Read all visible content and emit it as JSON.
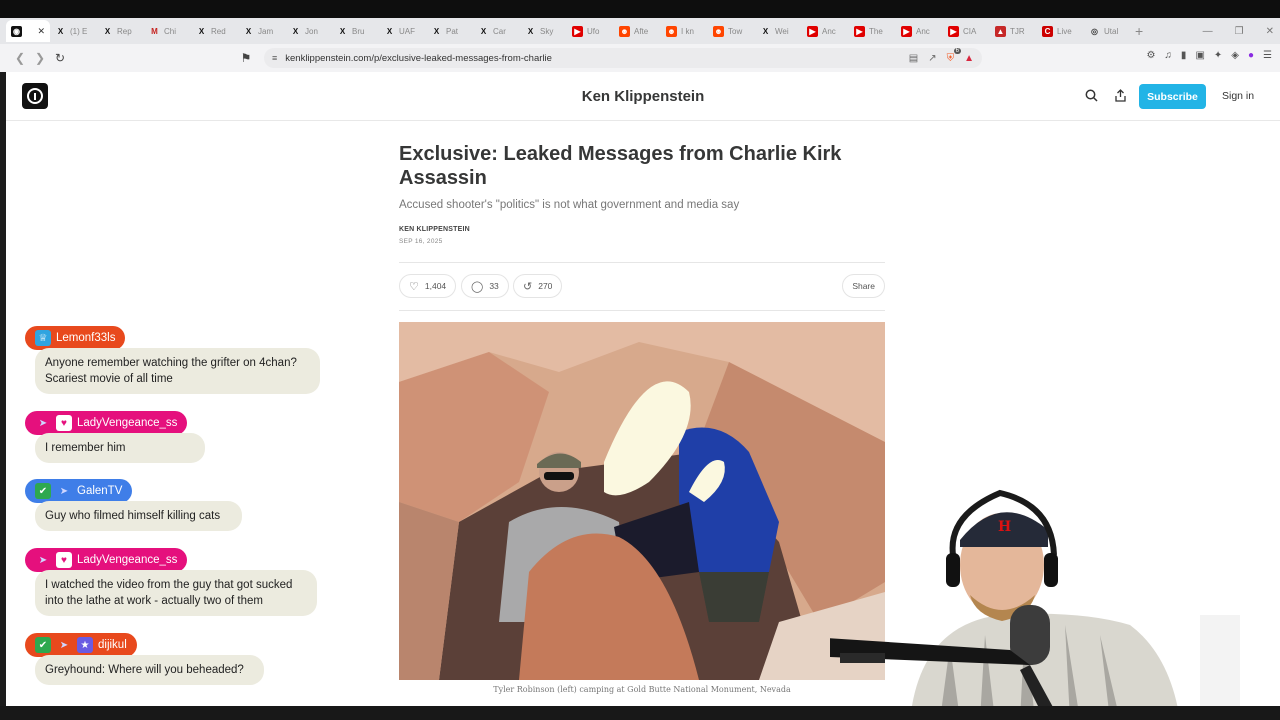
{
  "browser": {
    "tabs": [
      {
        "label": "",
        "fav": "site",
        "color": "#111111",
        "active": true
      },
      {
        "label": "(1) E",
        "fav": "x",
        "color": "#111111"
      },
      {
        "label": "Rep",
        "fav": "x",
        "color": "#111111"
      },
      {
        "label": "Chi",
        "fav": "gmail",
        "color": "#c5221f"
      },
      {
        "label": "Red",
        "fav": "x",
        "color": "#111111"
      },
      {
        "label": "Jam",
        "fav": "x",
        "color": "#111111"
      },
      {
        "label": "Jon",
        "fav": "x",
        "color": "#111111"
      },
      {
        "label": "Bru",
        "fav": "x",
        "color": "#111111"
      },
      {
        "label": "UAF",
        "fav": "x",
        "color": "#111111"
      },
      {
        "label": "Pat",
        "fav": "x",
        "color": "#111111"
      },
      {
        "label": "Car",
        "fav": "x",
        "color": "#111111"
      },
      {
        "label": "Sky",
        "fav": "x",
        "color": "#111111"
      },
      {
        "label": "Ufo",
        "fav": "youtube",
        "color": "#e00000"
      },
      {
        "label": "Afte",
        "fav": "reddit",
        "color": "#ff4500"
      },
      {
        "label": "I kn",
        "fav": "reddit",
        "color": "#ff4500"
      },
      {
        "label": "Tow",
        "fav": "reddit",
        "color": "#ff4500"
      },
      {
        "label": "Wei",
        "fav": "x",
        "color": "#111111"
      },
      {
        "label": "Anc",
        "fav": "youtube",
        "color": "#e00000"
      },
      {
        "label": "The",
        "fav": "youtube",
        "color": "#e00000"
      },
      {
        "label": "Anc",
        "fav": "youtube",
        "color": "#e00000"
      },
      {
        "label": "CIA",
        "fav": "youtube",
        "color": "#e00000"
      },
      {
        "label": "TJR",
        "fav": "pdf",
        "color": "#c62828"
      },
      {
        "label": "Live",
        "fav": "cnn",
        "color": "#cc0000"
      },
      {
        "label": "Utal",
        "fav": "globe",
        "color": "#444444"
      }
    ],
    "url": "kenklippenstein.com/p/exclusive-leaked-messages-from-charlie",
    "extension_badge": "6"
  },
  "site": {
    "title": "Ken Klippenstein",
    "subscribe_label": "Subscribe",
    "signin_label": "Sign in"
  },
  "article": {
    "headline": "Exclusive: Leaked Messages from Charlie Kirk Assassin",
    "subtitle": "Accused shooter's \"politics\" is not what government and media say",
    "author": "KEN KLIPPENSTEIN",
    "date": "SEP 16, 2025",
    "likes": "1,404",
    "comments": "33",
    "restacks": "270",
    "share_label": "Share",
    "caption": "Tyler Robinson (left) camping at Gold Butte National Monument, Nevada"
  },
  "chat": [
    {
      "user": "Lemonf33ls",
      "color": "#e8491d",
      "icons": [
        "crown"
      ],
      "message": "Anyone remember watching the grifter on 4chan? Scariest movie of all time"
    },
    {
      "user": "LadyVengeance_ss",
      "color": "#e5107d",
      "icons": [
        "wings",
        "heart"
      ],
      "message": "I remember him"
    },
    {
      "user": "GalenTV",
      "color": "#3f7ee8",
      "icons": [
        "check",
        "wings"
      ],
      "message": "Guy who filmed himself killing cats"
    },
    {
      "user": "LadyVengeance_ss",
      "color": "#e5107d",
      "icons": [
        "wings",
        "heart"
      ],
      "message": "I watched the video from the guy that got sucked into the lathe at work - actually two of them"
    },
    {
      "user": "dijikul",
      "color": "#e8491d",
      "icons": [
        "check",
        "wings",
        "gift"
      ],
      "message": "Greyhound: Where will you beheaded?"
    }
  ]
}
